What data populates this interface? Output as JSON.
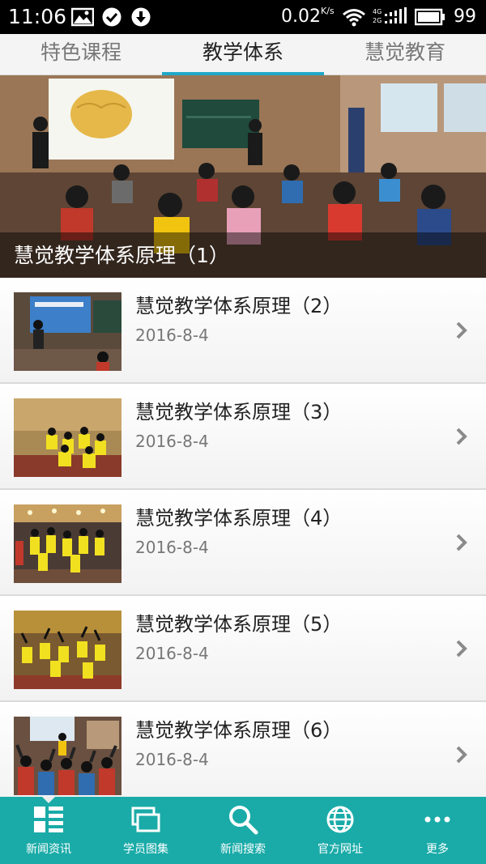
{
  "status_bar": {
    "time": "11:06",
    "net_speed": "0.02",
    "net_unit": "K/s",
    "network_type_top": "4G",
    "network_type_bottom": "2G",
    "battery": "99"
  },
  "tabs": [
    {
      "label": "特色课程",
      "active": false
    },
    {
      "label": "教学体系",
      "active": true
    },
    {
      "label": "慧觉教育",
      "active": false
    }
  ],
  "banner": {
    "caption": "慧觉教学体系原理（1）"
  },
  "list": [
    {
      "title": "慧觉教学体系原理（2）",
      "date": "2016-8-4"
    },
    {
      "title": "慧觉教学体系原理（3）",
      "date": "2016-8-4"
    },
    {
      "title": "慧觉教学体系原理（4）",
      "date": "2016-8-4"
    },
    {
      "title": "慧觉教学体系原理（5）",
      "date": "2016-8-4"
    },
    {
      "title": "慧觉教学体系原理（6）",
      "date": "2016-8-4"
    }
  ],
  "bottom_nav": [
    {
      "label": "新闻资讯",
      "icon": "news-list-icon",
      "active": true
    },
    {
      "label": "学员图集",
      "icon": "gallery-icon",
      "active": false
    },
    {
      "label": "新闻搜索",
      "icon": "search-icon",
      "active": false
    },
    {
      "label": "官方网址",
      "icon": "globe-icon",
      "active": false
    },
    {
      "label": "更多",
      "icon": "more-icon",
      "active": false
    }
  ],
  "colors": {
    "accent": "#1fa8c9",
    "bottom_nav_bg": "#1aaba8"
  }
}
